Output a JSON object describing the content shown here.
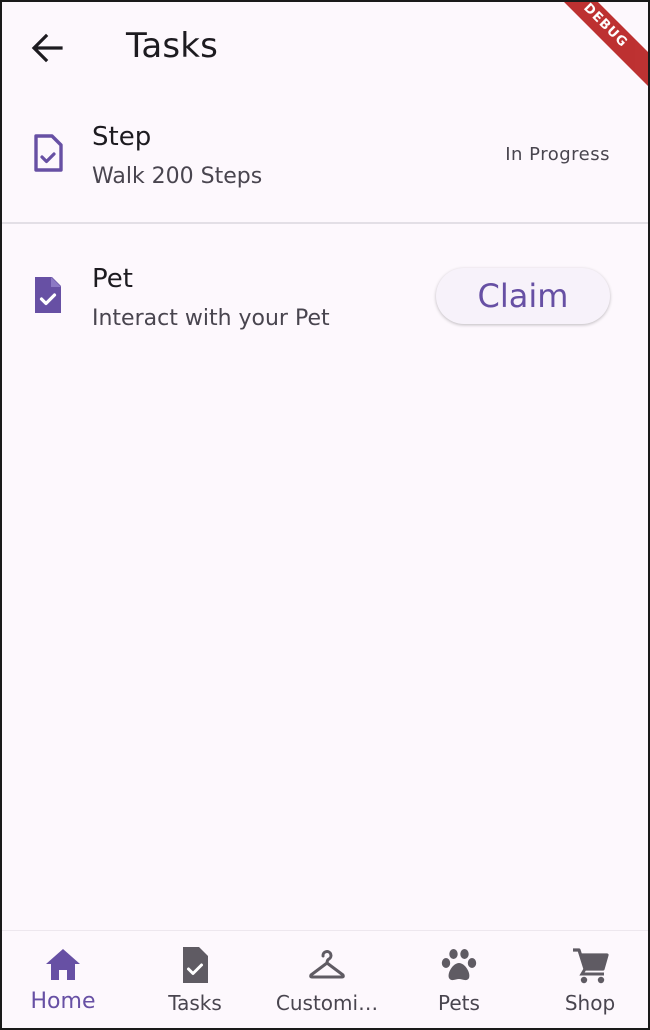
{
  "appbar": {
    "title": "Tasks",
    "debug_label": "DEBUG"
  },
  "tasks": [
    {
      "title": "Step",
      "subtitle": "Walk 200 Steps",
      "status": "In Progress",
      "icon": "task-outline-icon"
    },
    {
      "title": "Pet",
      "subtitle": "Interact with your Pet",
      "action_label": "Claim",
      "icon": "task-filled-icon"
    }
  ],
  "nav": {
    "items": [
      {
        "label": "Home",
        "icon": "home-icon",
        "active": true
      },
      {
        "label": "Tasks",
        "icon": "task-icon",
        "active": false
      },
      {
        "label": "Customi…",
        "icon": "hanger-icon",
        "active": false
      },
      {
        "label": "Pets",
        "icon": "paw-icon",
        "active": false
      },
      {
        "label": "Shop",
        "icon": "cart-icon",
        "active": false
      }
    ]
  },
  "colors": {
    "primary": "#6750a4",
    "background": "#fdf8fd",
    "text": "#1d1b20",
    "secondary_text": "#49454f",
    "inactive_icon": "#5f5b63",
    "debug_banner": "#b71c1c"
  }
}
